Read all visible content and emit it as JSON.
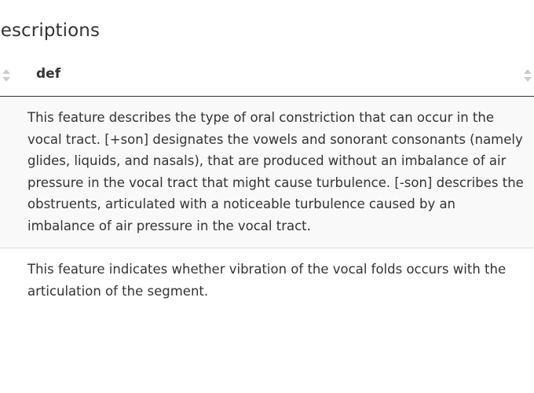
{
  "section": {
    "title": "descriptions"
  },
  "table": {
    "columns": [
      {
        "label": "def"
      }
    ],
    "rows": [
      {
        "def": "This feature describes the type of oral constriction that can occur in the vocal tract. [+son] designates the vowels and sonorant consonants (namely glides, liquids, and nasals), that are produced without an imbalance of air pressure in the vocal tract that might cause turbulence. [-son] describes the obstruents, articulated with a noticeable turbulence caused by an imbalance of air pressure in the vocal tract."
      },
      {
        "def": "This feature indicates whether vibration of the vocal folds occurs with the articulation of the segment."
      }
    ]
  },
  "icons": {
    "sort_left": "sort-both-icon",
    "sort_right": "sort-both-icon"
  },
  "colors": {
    "text": "#333333",
    "sort_icon": "#cccccc",
    "stripe": "#f9f9f9",
    "header_border": "#333333",
    "row_border": "#dddddd"
  }
}
